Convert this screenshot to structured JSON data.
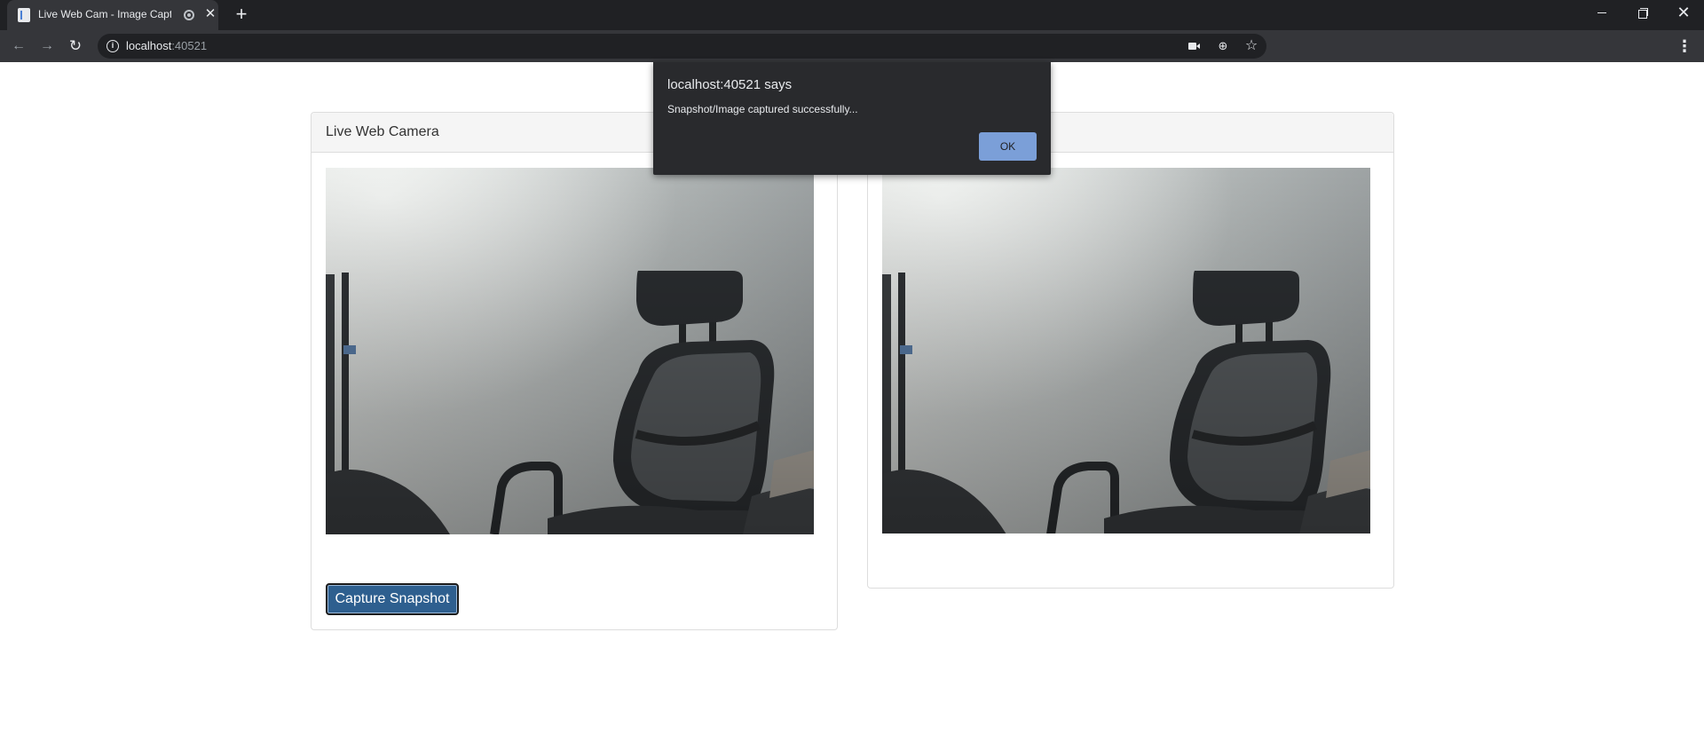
{
  "browser": {
    "tab": {
      "title": "Live Web Cam - Image Captu",
      "favicon": "page-icon",
      "audio_indicator": "recording-indicator-icon",
      "close_label": "✕"
    },
    "new_tab_label": "+",
    "window_controls": {
      "minimize": "minimize-icon",
      "restore": "restore-icon",
      "close_label": "✕"
    },
    "nav": {
      "back_label": "←",
      "forward_label": "→",
      "reload_label": "↻"
    },
    "address": {
      "info_label": "i",
      "host": "localhost",
      "port": ":40521"
    },
    "omnibox_icons": {
      "camera": "camera-icon",
      "zoom_label": "⊕",
      "bookmark_label": "☆"
    },
    "menu_label": "⋮"
  },
  "page": {
    "left_panel": {
      "heading": "Live Web Camera",
      "feed": "live-webcam-feed",
      "capture_button_label": "Capture Snapshot"
    },
    "right_panel": {
      "heading": "",
      "image": "captured-snapshot"
    }
  },
  "dialog": {
    "title": "localhost:40521 says",
    "message": "Snapshot/Image captured successfully...",
    "ok_label": "OK"
  },
  "colors": {
    "chrome_dark": "#202124",
    "chrome_toolbar": "#35363a",
    "button_primary": "#2e5f8f",
    "dialog_bg": "#292a2d",
    "dialog_ok": "#7b9fd8"
  }
}
